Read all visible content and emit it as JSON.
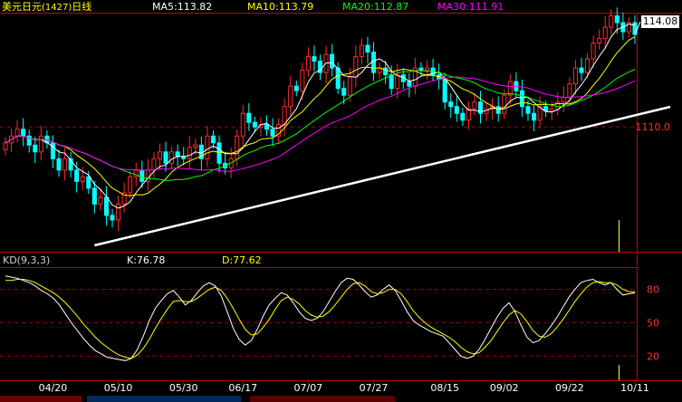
{
  "header": {
    "title": "美元日元",
    "code": "(1427)",
    "period": "日线",
    "ma5": "MA5:113.82",
    "ma10": "MA10:113.79",
    "ma20": "MA20:112.87",
    "ma30": "MA30:111.91",
    "last_price": "114.08"
  },
  "kd_header": {
    "label": "KD(9,3,3)",
    "k": "K:76.78",
    "d": "D:77.62"
  },
  "colors": {
    "background": "#000000",
    "up_candle": "#ff2a2a",
    "down_candle": "#00ffff",
    "ma5": "#ffffff",
    "ma10": "#ffff00",
    "ma20": "#00ff00",
    "ma30": "#ff00ff",
    "grid": "#a00000",
    "trendline": "#ffffff"
  },
  "chart_data": [
    {
      "type": "candlestick",
      "title": "美元日元(1427)日线",
      "x_ticks": [
        "04/20",
        "05/10",
        "05/30",
        "06/17",
        "07/07",
        "07/27",
        "08/15",
        "09/02",
        "09/22",
        "10/11"
      ],
      "y_ticks": [
        110.0,
        114.08
      ],
      "ylim": [
        104.5,
        115.0
      ],
      "close": [
        109.3,
        109.6,
        109.9,
        109.6,
        109.2,
        108.9,
        109.6,
        109.3,
        108.6,
        108.1,
        108.6,
        108.1,
        107.6,
        107.8,
        107.3,
        106.6,
        106.9,
        106.1,
        105.9,
        106.6,
        107.1,
        107.8,
        108.1,
        107.6,
        108.1,
        108.6,
        108.9,
        108.4,
        108.9,
        108.7,
        108.6,
        109.1,
        109.2,
        108.6,
        109.6,
        109.3,
        108.4,
        108.2,
        108.6,
        109.6,
        110.6,
        110.2,
        110.0,
        110.1,
        109.9,
        109.6,
        110.1,
        110.9,
        111.8,
        111.6,
        112.5,
        113.1,
        112.9,
        112.4,
        113.2,
        112.6,
        111.7,
        111.4,
        112.2,
        113.1,
        113.6,
        113.3,
        112.4,
        112.6,
        112.3,
        111.7,
        112.3,
        112.0,
        111.8,
        112.6,
        112.5,
        112.6,
        112.3,
        112.1,
        111.1,
        110.9,
        110.6,
        110.3,
        110.8,
        111.1,
        110.6,
        110.8,
        110.9,
        110.6,
        111.4,
        112.0,
        111.6,
        110.9,
        110.6,
        110.3,
        110.9,
        110.7,
        110.8,
        111.1,
        111.3,
        111.9,
        112.6,
        112.4,
        113.0,
        113.7,
        113.9,
        114.4,
        114.9,
        114.6,
        114.2,
        114.6,
        114.08
      ]
    },
    {
      "type": "line",
      "title": "KD(9,3,3)",
      "y_ticks": [
        20,
        50,
        80
      ],
      "ylim": [
        0,
        100
      ],
      "series": [
        {
          "name": "K",
          "values": [
            92,
            91,
            90,
            88,
            86,
            83,
            79,
            76,
            72,
            66,
            58,
            50,
            43,
            36,
            30,
            25,
            22,
            19,
            18,
            17,
            16,
            18,
            26,
            38,
            52,
            63,
            70,
            76,
            79,
            73,
            66,
            70,
            77,
            83,
            86,
            83,
            74,
            60,
            45,
            35,
            30,
            34,
            44,
            56,
            66,
            72,
            77,
            75,
            68,
            60,
            54,
            52,
            54,
            60,
            69,
            78,
            86,
            90,
            89,
            84,
            78,
            73,
            75,
            80,
            84,
            79,
            70,
            60,
            52,
            48,
            45,
            42,
            40,
            38,
            32,
            26,
            20,
            18,
            20,
            26,
            35,
            45,
            55,
            63,
            68,
            60,
            48,
            37,
            32,
            34,
            40,
            47,
            55,
            64,
            73,
            80,
            86,
            88,
            89,
            86,
            84,
            86,
            80,
            75,
            76,
            76.78
          ]
        },
        {
          "name": "D",
          "values": [
            88,
            88,
            89,
            89,
            88,
            86,
            83,
            80,
            77,
            73,
            68,
            62,
            56,
            49,
            43,
            37,
            32,
            28,
            24,
            21,
            19,
            18,
            21,
            27,
            35,
            45,
            54,
            62,
            69,
            70,
            69,
            69,
            72,
            76,
            80,
            82,
            79,
            72,
            63,
            53,
            44,
            39,
            40,
            46,
            53,
            62,
            70,
            73,
            71,
            67,
            61,
            57,
            55,
            56,
            60,
            66,
            73,
            80,
            85,
            86,
            83,
            78,
            76,
            77,
            80,
            80,
            76,
            69,
            61,
            55,
            50,
            46,
            43,
            40,
            37,
            33,
            28,
            24,
            22,
            23,
            28,
            34,
            42,
            50,
            57,
            61,
            58,
            51,
            43,
            38,
            37,
            40,
            46,
            53,
            61,
            69,
            76,
            82,
            86,
            87,
            86,
            86,
            84,
            80,
            78,
            77.62
          ]
        }
      ]
    }
  ]
}
